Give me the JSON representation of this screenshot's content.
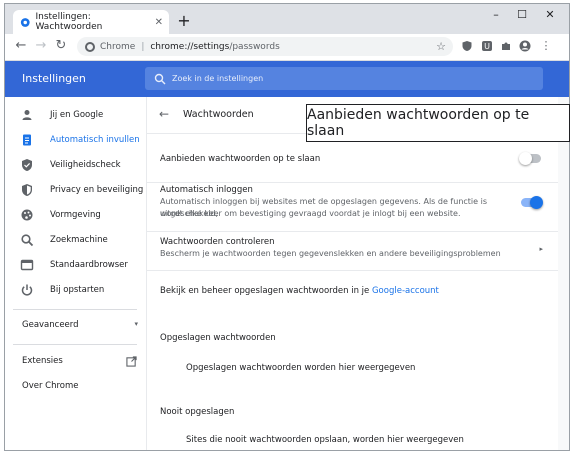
{
  "browser": {
    "tab_title": "Instellingen: Wachtwoorden",
    "tab_close": "✕",
    "new_tab": "+",
    "window_controls": {
      "minimize": "–",
      "maximize": "☐",
      "close": "✕"
    },
    "omnibox": {
      "chip_label": "Chrome",
      "separator": "|",
      "url_host": "chrome://settings",
      "url_path": "/passwords"
    },
    "extension_icons": [
      "shield-extension-icon",
      "u-extension-icon",
      "puzzle-icon",
      "account-icon",
      "kebab-menu-icon"
    ]
  },
  "settings": {
    "header_title": "Instellingen",
    "search_placeholder": "Zoek in de instellingen",
    "sidebar": {
      "items": [
        {
          "label": "Jij en Google",
          "icon": "person-icon"
        },
        {
          "label": "Automatisch invullen",
          "icon": "autofill-icon",
          "active": true
        },
        {
          "label": "Veiligheidscheck",
          "icon": "shield-check-icon"
        },
        {
          "label": "Privacy en beveiliging",
          "icon": "privacy-shield-icon"
        },
        {
          "label": "Vormgeving",
          "icon": "palette-icon"
        },
        {
          "label": "Zoekmachine",
          "icon": "search-icon"
        },
        {
          "label": "Standaardbrowser",
          "icon": "browser-icon"
        },
        {
          "label": "Bij opstarten",
          "icon": "power-icon"
        }
      ],
      "advanced": "Geavanceerd",
      "extensions": "Extensies",
      "about": "Over Chrome"
    },
    "page": {
      "title": "Wachtwoorden",
      "offer_save": {
        "label": "Aanbieden wachtwoorden op te slaan",
        "enabled": false
      },
      "auto_signin": {
        "label": "Automatisch inloggen",
        "description_line1": "Automatisch inloggen bij websites met de opgeslagen gegevens. Als de functie is uitgeschakeld,",
        "description_line2": "wordt elke keer om bevestiging gevraagd voordat je inlogt bij een website.",
        "enabled": true
      },
      "check_passwords": {
        "label": "Wachtwoorden controleren",
        "description": "Bescherm je wachtwoorden tegen gegevenslekken en andere beveiligingsproblemen"
      },
      "manage_text": "Bekijk en beheer opgeslagen wachtwoorden in je",
      "manage_link": "Google-account",
      "saved_title": "Opgeslagen wachtwoorden",
      "saved_empty": "Opgeslagen wachtwoorden worden hier weergegeven",
      "never_title": "Nooit opgeslagen",
      "never_empty": "Sites die nooit wachtwoorden opslaan, worden hier weergegeven"
    }
  },
  "callout_text": "Aanbieden wachtwoorden op te slaan",
  "colors": {
    "accent": "#1a73e8",
    "header": "#3367d6"
  }
}
